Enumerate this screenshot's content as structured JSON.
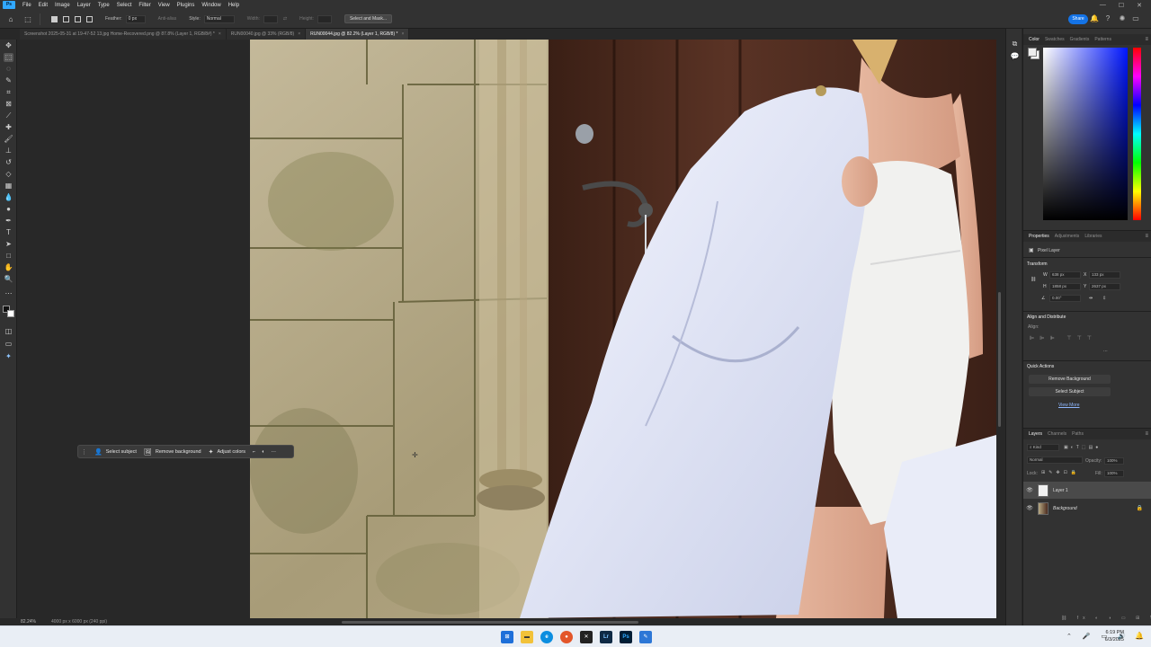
{
  "app": {
    "logo": "Ps"
  },
  "menu": [
    "File",
    "Edit",
    "Image",
    "Layer",
    "Type",
    "Select",
    "Filter",
    "View",
    "Plugins",
    "Window",
    "Help"
  ],
  "window_controls": {
    "minimize": "—",
    "maximize": "☐",
    "close": "✕"
  },
  "options_bar": {
    "feather_label": "Feather:",
    "feather_value": "0 px",
    "anti_alias_label": "Anti-alias",
    "style_label": "Style:",
    "style_value": "Normal",
    "width_label": "Width:",
    "height_label": "Height:",
    "select_mask_button": "Select and Mask..."
  },
  "share_button": "Share",
  "tabs": [
    {
      "label": "Screenshot 2025-05-31 at 19-47-52 13.jpg Home-Recovered.png @ 87.8% (Layer 1, RGB/8#) *",
      "close": "×"
    },
    {
      "label": "RUN00040.jpg @ 33% (RGB/8)",
      "close": "×"
    },
    {
      "label": "RUN00044.jpg @ 82.2% (Layer 1, RGB/8) *",
      "close": "×"
    }
  ],
  "contextual_bar": {
    "select_subject": "Select subject",
    "remove_background": "Remove background",
    "adjust_colors": "Adjust colors"
  },
  "status_bar": {
    "zoom": "82.24%",
    "doc_size": "4000 px x 6000 px (240 ppi)"
  },
  "color_panel": {
    "tabs": [
      "Color",
      "Swatches",
      "Gradients",
      "Patterns"
    ],
    "active": "Color"
  },
  "properties_panel": {
    "tabs": [
      "Properties",
      "Adjustments",
      "Libraries"
    ],
    "type": "Pixel Layer",
    "transform_heading": "Transform",
    "w_label": "W",
    "w_value": "638 px",
    "x_label": "X",
    "x_value": "133 px",
    "h_label": "H",
    "h_value": "1858 px",
    "y_label": "Y",
    "y_value": "2637 px",
    "angle_value": "0.00°",
    "align_heading": "Align and Distribute",
    "align_label": "Align:",
    "quick_actions_heading": "Quick Actions",
    "remove_background_button": "Remove Background",
    "select_subject_button": "Select Subject",
    "view_more": "View More"
  },
  "layers_panel": {
    "tabs": [
      "Layers",
      "Channels",
      "Paths"
    ],
    "kind_label": "Kind",
    "blend_mode": "Normal",
    "opacity_label": "Opacity:",
    "opacity_value": "100%",
    "lock_label": "Lock:",
    "fill_label": "Fill:",
    "fill_value": "100%",
    "layers": [
      {
        "name": "Layer 1",
        "selected": true
      },
      {
        "name": "Background",
        "locked": true
      }
    ]
  },
  "taskbar": {
    "time": "6:19 PM",
    "date": "6/3/2025"
  }
}
